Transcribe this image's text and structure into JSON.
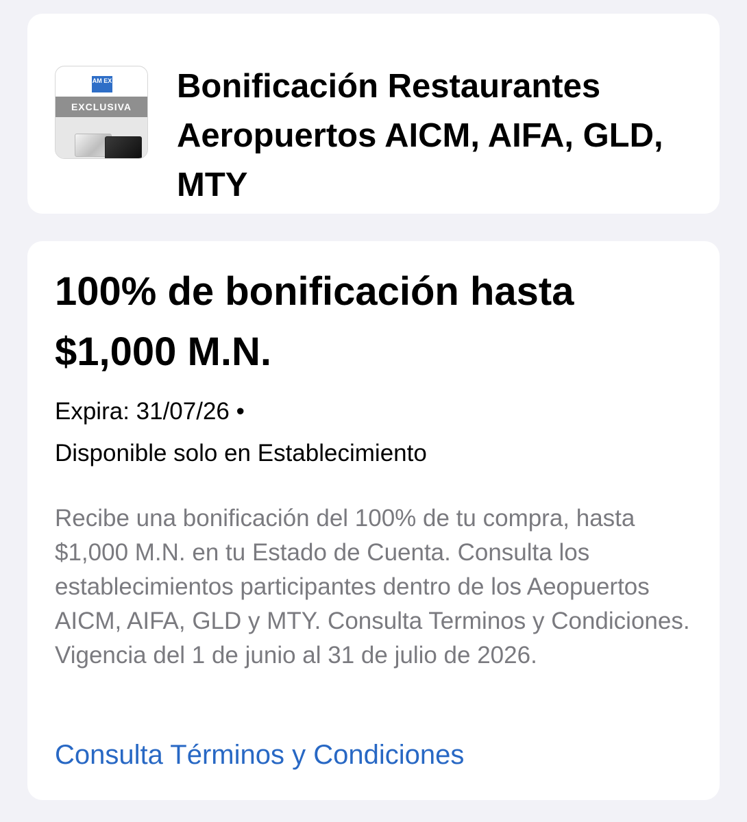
{
  "offer": {
    "thumbnail": {
      "logo_text": "AM EX",
      "badge": "EXCLUSIVA"
    },
    "title": "Bonificación Restaurantes Aeropuertos AICM, AIFA, GLD, MTY"
  },
  "details": {
    "headline": "100% de bonificación hasta $1,000 M.N.",
    "expiry": "Expira: 31/07/26 •",
    "availability": "Disponible solo en Establecimiento",
    "description": "Recibe una bonificación del 100% de tu compra, hasta $1,000 M.N. en tu Estado de Cuenta. Consulta los establecimientos participantes dentro de los Aeopuertos AICM, AIFA, GLD y MTY. Consulta Terminos y Condiciones. Vigencia del 1 de junio al 31 de julio de 2026.",
    "terms_link": "Consulta Términos y Condiciones"
  },
  "colors": {
    "background": "#f2f2f7",
    "card": "#ffffff",
    "link": "#2868c4",
    "secondary_text": "#7a7a7f",
    "amex_blue": "#2e6ec7"
  }
}
